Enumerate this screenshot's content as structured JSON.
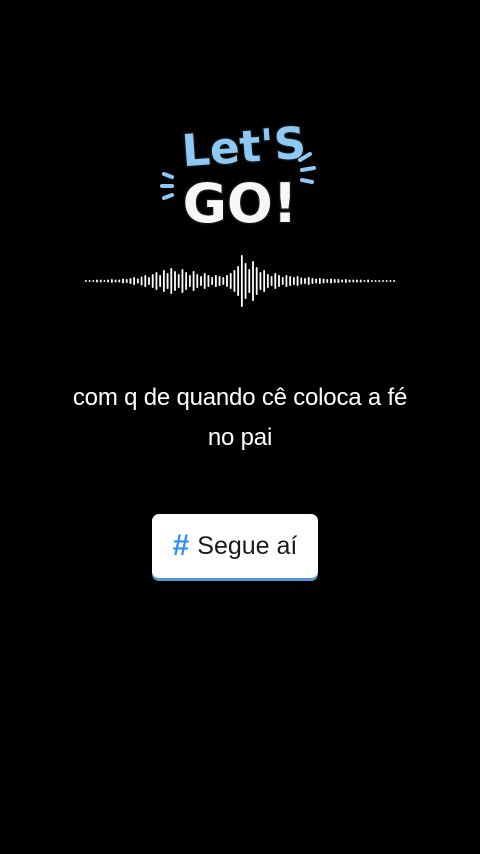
{
  "sticker": {
    "line1": "Let'S",
    "line2": "GO!"
  },
  "colors": {
    "background": "#000000",
    "sticker_blue": "#8ec9f5",
    "sticker_white": "#f7f7f7",
    "hash_blue": "#2f8ff0",
    "button_shadow": "#5a96d6"
  },
  "caption": {
    "line1": "com q de quando cê coloca a fé",
    "line2": "no pai"
  },
  "hashtag_button": {
    "hash": "#",
    "label": "Segue aí"
  }
}
